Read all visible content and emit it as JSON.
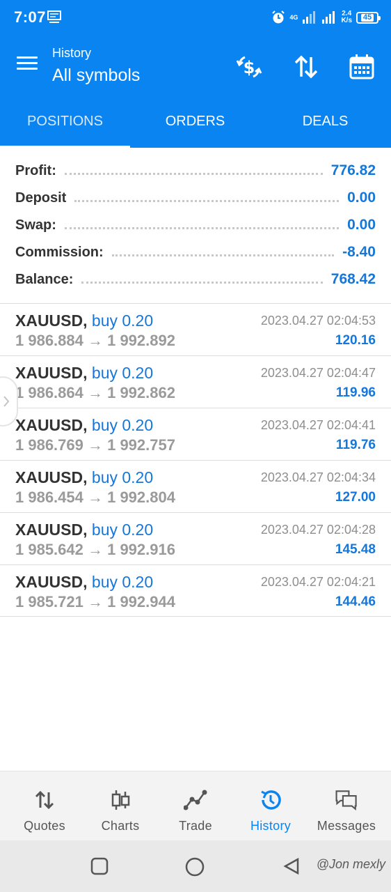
{
  "status_bar": {
    "time": "7:07",
    "network": "4G",
    "speed_top": "2.4",
    "speed_bottom": "K/s",
    "battery": "45"
  },
  "header": {
    "subtitle": "History",
    "title": "All symbols",
    "icons": [
      "currency-swap-icon",
      "sort-icon",
      "calendar-icon"
    ]
  },
  "tabs": [
    {
      "label": "POSITIONS",
      "active": true
    },
    {
      "label": "ORDERS",
      "active": false
    },
    {
      "label": "DEALS",
      "active": false
    }
  ],
  "summary": [
    {
      "label": "Profit:",
      "value": "776.82"
    },
    {
      "label": "Deposit",
      "value": "0.00"
    },
    {
      "label": "Swap:",
      "value": "0.00"
    },
    {
      "label": "Commission:",
      "value": "-8.40"
    },
    {
      "label": "Balance:",
      "value": "768.42"
    }
  ],
  "deals": [
    {
      "symbol": "XAUUSD,",
      "type": "buy 0.20",
      "prices": "1 986.884 → 1 992.892",
      "time": "2023.04.27 02:04:53",
      "profit": "120.16"
    },
    {
      "symbol": "XAUUSD,",
      "type": "buy 0.20",
      "prices": "1 986.864 → 1 992.862",
      "time": "2023.04.27 02:04:47",
      "profit": "119.96"
    },
    {
      "symbol": "XAUUSD,",
      "type": "buy 0.20",
      "prices": "1 986.769 → 1 992.757",
      "time": "2023.04.27 02:04:41",
      "profit": "119.76"
    },
    {
      "symbol": "XAUUSD,",
      "type": "buy 0.20",
      "prices": "1 986.454 → 1 992.804",
      "time": "2023.04.27 02:04:34",
      "profit": "127.00"
    },
    {
      "symbol": "XAUUSD,",
      "type": "buy 0.20",
      "prices": "1 985.642 → 1 992.916",
      "time": "2023.04.27 02:04:28",
      "profit": "145.48"
    },
    {
      "symbol": "XAUUSD,",
      "type": "buy 0.20",
      "prices": "1 985.721 → 1 992.944",
      "time": "2023.04.27 02:04:21",
      "profit": "144.46"
    }
  ],
  "bottom_nav": [
    {
      "label": "Quotes",
      "icon": "quotes-icon",
      "active": false
    },
    {
      "label": "Charts",
      "icon": "charts-icon",
      "active": false
    },
    {
      "label": "Trade",
      "icon": "trade-icon",
      "active": false
    },
    {
      "label": "History",
      "icon": "history-icon",
      "active": true
    },
    {
      "label": "Messages",
      "icon": "messages-icon",
      "active": false
    }
  ],
  "watermark": "@Jon mexly",
  "colors": {
    "primary": "#0a84f0",
    "accent_text": "#1577d9"
  }
}
